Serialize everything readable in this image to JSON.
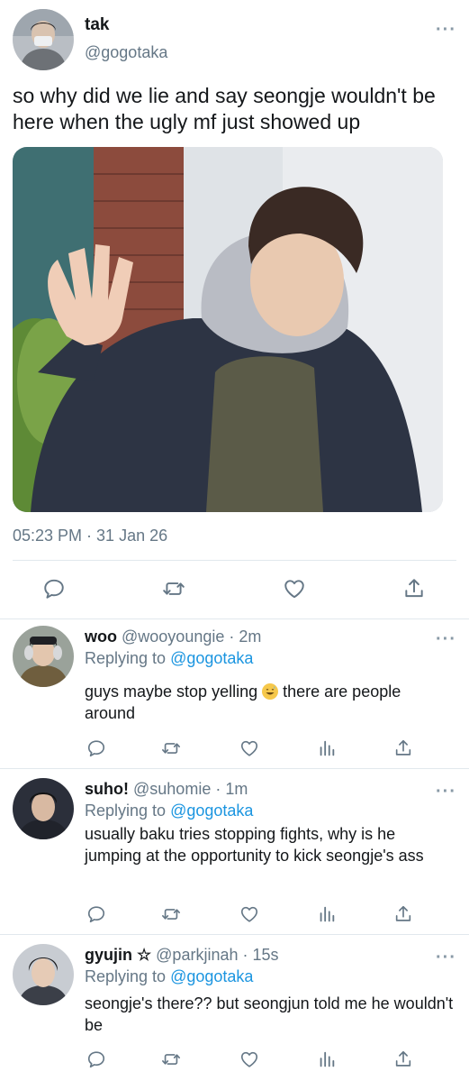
{
  "main_tweet": {
    "name": "tak",
    "handle": "@gogotaka",
    "text": "so why did we lie and say seongje wouldn't be here when the ugly mf just showed up",
    "timestamp": "05:23 PM · 31 Jan 26",
    "more_icon": "more-dots-icon",
    "actions": [
      "reply-icon",
      "retweet-icon",
      "like-icon",
      "share-icon"
    ]
  },
  "replies": [
    {
      "name": "woo",
      "handle": "@wooyoungie",
      "time": "· 2m",
      "replying_prefix": "Replying to",
      "replying_to": "@gogotaka",
      "text_before_emoji": "guys maybe stop yelling",
      "emoji": "grinning-sweat-emoji",
      "text_after_emoji": "there are people around"
    },
    {
      "name": "suho!",
      "handle": "@suhomie",
      "time": "· 1m",
      "replying_prefix": "Replying to",
      "replying_to": "@gogotaka",
      "text": "usually baku tries stopping fights, why is he jumping at the opportunity to kick seongje's ass"
    },
    {
      "name": "gyujin ☆",
      "handle": "@parkjinah",
      "time": "· 15s",
      "replying_prefix": "Replying to",
      "replying_to": "@gogotaka",
      "text": "seongje's there?? but seongjun told me he wouldn't be"
    }
  ],
  "reply_actions": [
    "reply-icon",
    "retweet-icon",
    "like-icon",
    "analytics-icon",
    "share-icon"
  ],
  "colors": {
    "text": "#14171a",
    "secondary": "#657786",
    "link": "#1b95e0",
    "divider": "#e1e8ed",
    "icon": "#657786"
  }
}
